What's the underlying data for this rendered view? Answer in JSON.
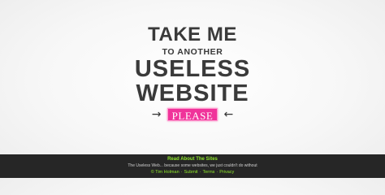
{
  "hero": {
    "line1": "TAKE ME",
    "line2": "TO ANOTHER",
    "line3": "USELESS",
    "line4": "WEBSITE",
    "button_label": "PLEASE",
    "arrow_left": "→",
    "arrow_right": "←"
  },
  "footer": {
    "about_link": "Read About The Sites",
    "tagline": "The Useless Web... because some websites, we just couldn't do without",
    "credit": "© Tim Holman",
    "submit_link": "Submit",
    "terms_link": "Terms",
    "privacy_link": "Privacy",
    "separator": "·"
  },
  "colors": {
    "accent_pink": "#f0339a",
    "footer_bg": "#262626",
    "footer_link": "#8ee62c",
    "title_text": "#3a3a3a"
  }
}
